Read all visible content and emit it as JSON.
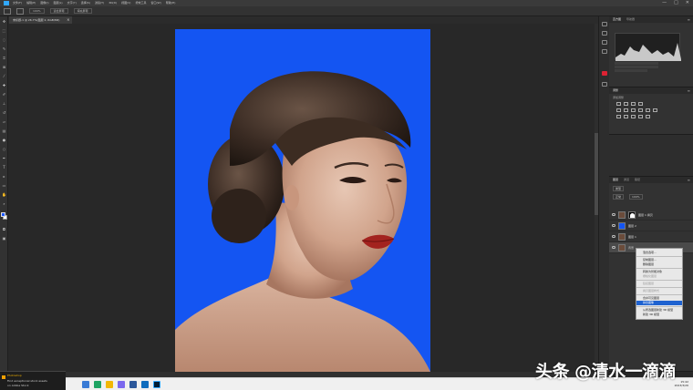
{
  "app": {
    "menu": [
      "文件(F)",
      "编辑(E)",
      "图像(I)",
      "图层(L)",
      "文字(Y)",
      "选择(S)",
      "滤镜(T)",
      "3D(D)",
      "视图(V)",
      "增效工具",
      "窗口(W)",
      "帮助(H)"
    ],
    "window_controls": [
      "—",
      "□",
      "✕"
    ]
  },
  "options_bar": {
    "zoom": "100%",
    "buttons": [
      "适合屏幕",
      "填充屏幕"
    ]
  },
  "document_tab": {
    "title": "未标题-1 @ 26.7%(图层 2, RGB/8#)",
    "close": "×"
  },
  "panels": {
    "histogram": {
      "tabs": [
        "直方图",
        "导航器"
      ]
    },
    "adjustments": {
      "tabs": [
        "调整"
      ],
      "subtitle": "添加调整"
    },
    "layers": {
      "tabs": [
        "图层",
        "通道",
        "路径"
      ],
      "kind_filter": "类型",
      "blend_mode": "正常",
      "opacity": "100%",
      "items": [
        {
          "name": "图层 1 拷贝",
          "thumb": "#6b4c3b",
          "has_mask": true
        },
        {
          "name": "图层 2",
          "thumb": "#1455f2",
          "has_mask": false
        },
        {
          "name": "图层 1",
          "thumb": "#6b4c3b",
          "has_mask": false
        },
        {
          "name": "背景",
          "thumb": "#6b4c3b",
          "has_mask": false,
          "selected": true
        }
      ]
    }
  },
  "context_menu": {
    "items": [
      {
        "label": "混合选项...",
        "state": "normal"
      },
      {
        "sep": true
      },
      {
        "label": "复制图层...",
        "state": "normal"
      },
      {
        "label": "删除图层",
        "state": "normal"
      },
      {
        "sep": true
      },
      {
        "label": "转换为智能对象",
        "state": "normal"
      },
      {
        "label": "栅格化图层",
        "state": "disabled"
      },
      {
        "sep": true
      },
      {
        "label": "链接图层",
        "state": "disabled"
      },
      {
        "sep": true
      },
      {
        "label": "拷贝图层样式",
        "state": "disabled"
      },
      {
        "sep": true
      },
      {
        "label": "合并可见图层",
        "state": "normal"
      },
      {
        "label": "拼合图像",
        "state": "highlight"
      },
      {
        "sep": true
      },
      {
        "label": "从所选图层新建 3D 模型",
        "state": "normal"
      },
      {
        "label": "新建 3D 模型",
        "state": "normal"
      }
    ]
  },
  "notification": {
    "title": "Photoshop",
    "line1": "Find exceptional stock assets",
    "line2": "on Adobe Stock"
  },
  "taskbar": {
    "time": "15:42",
    "date": "2023/3/26"
  },
  "watermark": {
    "text": "头条 @清水一滴滴"
  },
  "colors": {
    "canvas_bg": "#1455f2",
    "foreground": "#1e5aff",
    "accent": "#31a8ff",
    "menu_highlight": "#1e62d0"
  }
}
